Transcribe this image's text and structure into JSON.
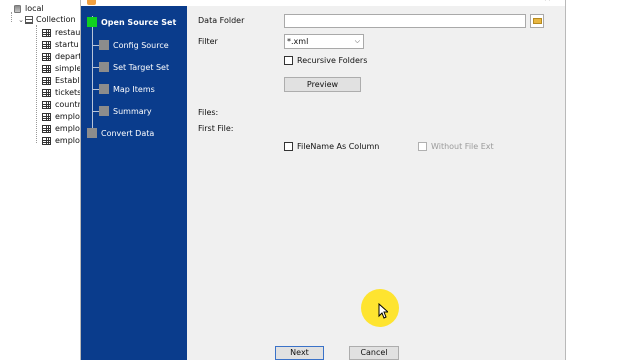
{
  "tree": {
    "root_label": "local",
    "collection_label": "Collection",
    "items": [
      "restau",
      "startu",
      "depart",
      "simple",
      "Establi",
      "tickets",
      "countr",
      "emplo",
      "emplo",
      "emplo"
    ]
  },
  "dialog": {
    "steps": [
      {
        "label": "Open Source Set",
        "active": true
      },
      {
        "label": "Config Source",
        "active": false
      },
      {
        "label": "Set Target Set",
        "active": false
      },
      {
        "label": "Map Items",
        "active": false
      },
      {
        "label": "Summary",
        "active": false
      },
      {
        "label": "Convert Data",
        "active": false
      }
    ],
    "form": {
      "data_folder_label": "Data Folder",
      "data_folder_value": "",
      "filter_label": "Filter",
      "filter_value": "*.xml",
      "recursive_label": "Recursive Folders",
      "preview_label": "Preview",
      "files_label": "Files:",
      "first_file_label": "First File:",
      "filename_column_label": "FileName As Column",
      "without_ext_label": "Without File Ext"
    },
    "buttons": {
      "next": "Next",
      "cancel": "Cancel"
    }
  },
  "colors": {
    "sidebar": "#0a3c8c",
    "active_step": "#10d020",
    "cursor_highlight": "#ffe114"
  }
}
